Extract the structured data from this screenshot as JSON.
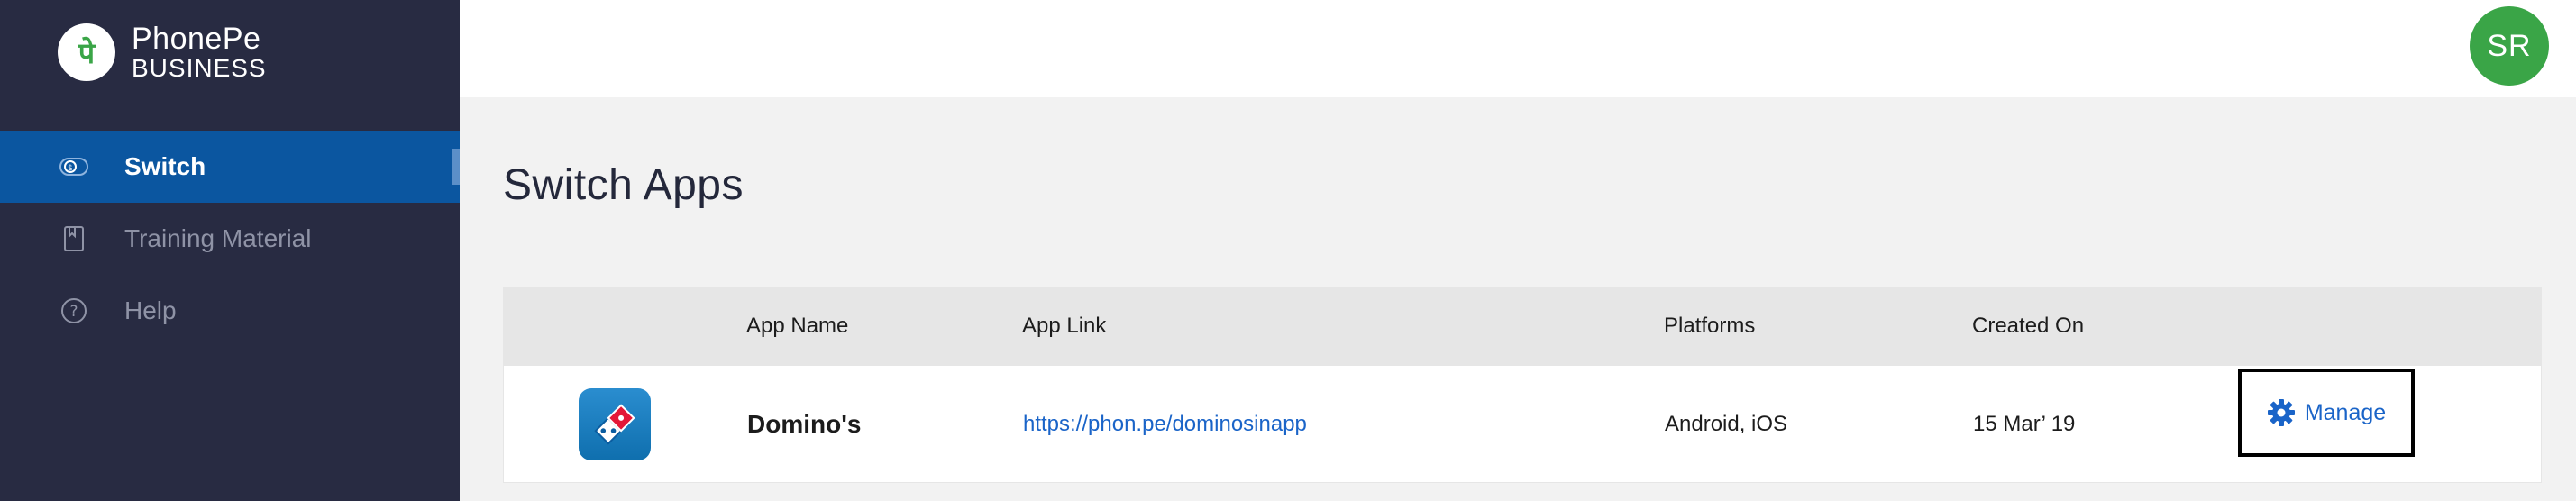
{
  "brand": {
    "line1": "PhonePe",
    "line2": "BUSINESS",
    "glyph": "पे",
    "color": "#5f259f"
  },
  "sidebar": {
    "items": [
      {
        "label": "Switch",
        "icon": "toggle-icon",
        "active": true
      },
      {
        "label": "Training Material",
        "icon": "book-icon",
        "active": false
      },
      {
        "label": "Help",
        "icon": "help-circle-icon",
        "active": false
      }
    ]
  },
  "header": {
    "avatar_initials": "SR",
    "avatar_color": "#3aa547"
  },
  "main": {
    "title": "Switch Apps",
    "table": {
      "columns": [
        "App Name",
        "App Link",
        "Platforms",
        "Created On"
      ],
      "rows": [
        {
          "icon": "dominos-logo-icon",
          "name": "Domino's",
          "link": "https://phon.pe/dominosinapp",
          "platforms": "Android, iOS",
          "created_on": "15 Mar’ 19",
          "action_label": "Manage"
        }
      ]
    }
  },
  "colors": {
    "sidebar_bg": "#282b42",
    "active_bg": "#0b56a0",
    "link": "#1a64c8"
  }
}
